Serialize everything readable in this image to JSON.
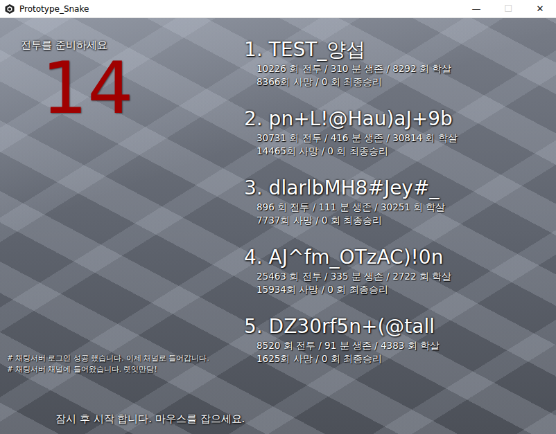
{
  "window": {
    "title": "Prototype_Snake",
    "controls": [
      {
        "glyph": "—",
        "disabled": false
      },
      {
        "glyph": "☐",
        "disabled": true
      },
      {
        "glyph": "✕",
        "disabled": false
      }
    ]
  },
  "countdown": {
    "label": "전투를 준비하세요",
    "value": "14"
  },
  "leaderboard": [
    {
      "name": "1. TEST_양섭",
      "stats": [
        "10226 회 전투 / 310 분 생존 / 8292 회 학살",
        "8366회 사망 / 0 회 최종승리"
      ]
    },
    {
      "name": "2. pn+L!@Hau)aJ+9b",
      "stats": [
        "30731 회 전투 / 416 분 생존 / 30814 회 학살",
        "14465회 사망 / 0 회 최종승리"
      ]
    },
    {
      "name": "3. dlarlbMH8#Jey#_",
      "stats": [
        "896 회 전투 / 111 분 생존 / 30251 회 학살",
        "7737회 사망 / 0 회 최종승리"
      ]
    },
    {
      "name": "4. AJ^fm_OTzAC)!0n",
      "stats": [
        "25463 회 전투 / 335 분 생존 / 2722 회 학살",
        "15934회 사망 / 0 회 최종승리"
      ]
    },
    {
      "name": "5. DZ30rf5n+(@tall",
      "stats": [
        "8520 회 전투 / 91 분 생존 / 4383 회 학살",
        "1625회 사망 / 0 회 최종승리"
      ]
    }
  ],
  "chat": [
    "# 채팅서버 로그인 성공 했습니다. 이제 채널로 들어갑니다.",
    "# 채팅서버 채널에 들어왔습니다. 렛잇만담!"
  ],
  "footer": "잠시 후 시작 합니다. 마우스를 잡으세요."
}
